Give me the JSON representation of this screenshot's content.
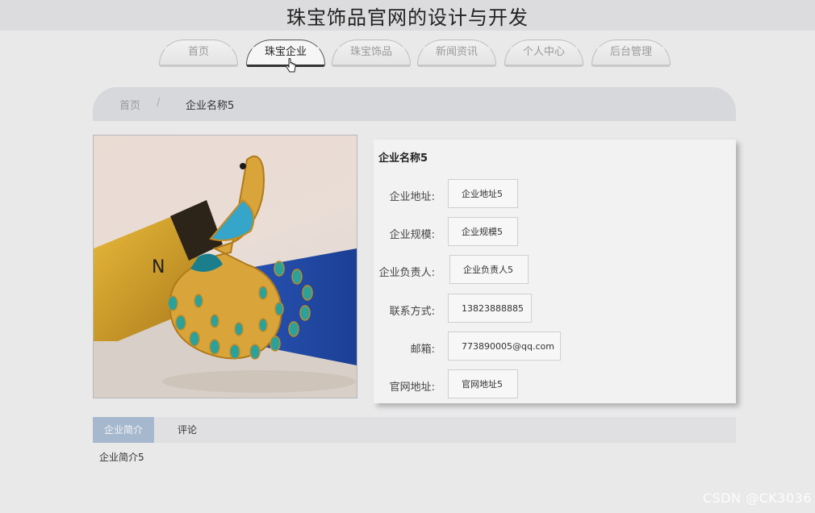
{
  "site": {
    "title": "珠宝饰品官网的设计与开发"
  },
  "nav": {
    "items": [
      {
        "label": "首页"
      },
      {
        "label": "珠宝企业"
      },
      {
        "label": "珠宝饰品"
      },
      {
        "label": "新闻资讯"
      },
      {
        "label": "个人中心"
      },
      {
        "label": "后台管理"
      }
    ],
    "active_index": 1
  },
  "breadcrumb": {
    "home": "首页",
    "separator": "/",
    "current": "企业名称5"
  },
  "detail": {
    "title": "企业名称5",
    "fields": [
      {
        "label": "企业地址:",
        "value": "企业地址5"
      },
      {
        "label": "企业规模:",
        "value": "企业规模5"
      },
      {
        "label": "企业负责人:",
        "value": "企业负责人5"
      },
      {
        "label": "联系方式:",
        "value": "13823888885"
      },
      {
        "label": "邮箱:",
        "value": "773890005@qq.com"
      },
      {
        "label": "官网地址:",
        "value": "官网地址5"
      }
    ]
  },
  "tabs": {
    "items": [
      {
        "label": "企业简介"
      },
      {
        "label": "评论"
      }
    ],
    "active_index": 0,
    "content": "企业简介5"
  },
  "watermark": "CSDN @CK3036",
  "colors": {
    "accent_tab": "#a6b8cd",
    "header_bg": "#dcdcde",
    "page_bg": "#e9e9ea"
  }
}
